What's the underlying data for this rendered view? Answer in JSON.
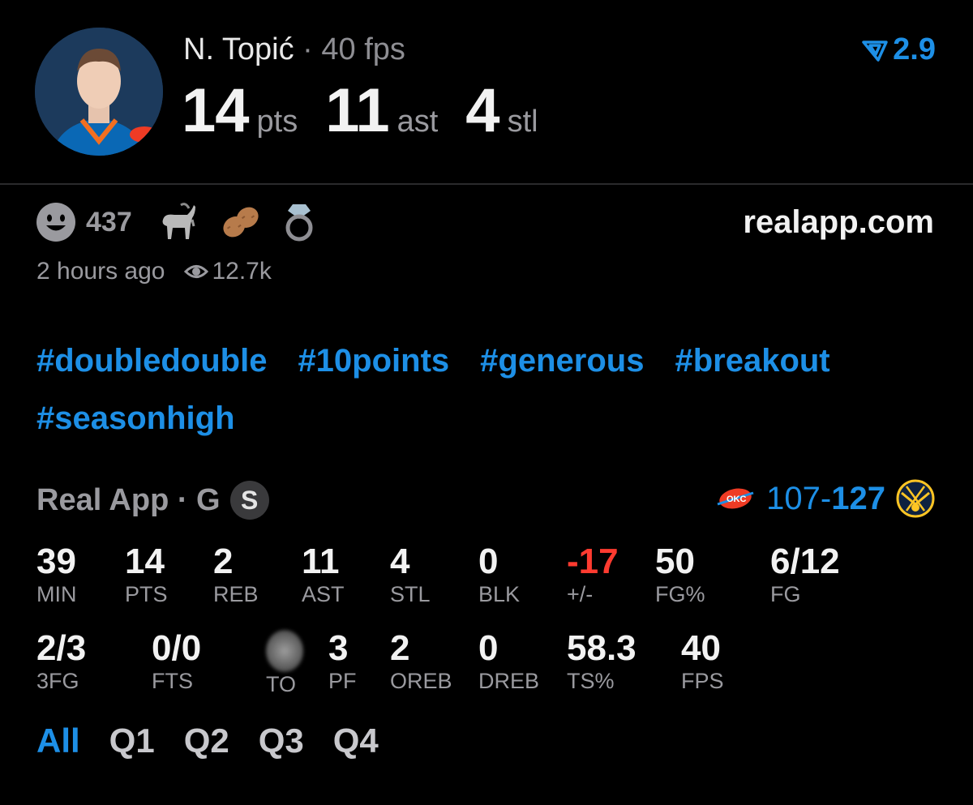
{
  "player": {
    "name": "N. Topić",
    "separator": "·",
    "fps_text": "40 fps",
    "headline": [
      {
        "value": "14",
        "unit": "pts"
      },
      {
        "value": "11",
        "unit": "ast"
      },
      {
        "value": "4",
        "unit": "stl"
      }
    ]
  },
  "rating": {
    "value": "2.9",
    "icon": "rating-arrow-icon",
    "color": "#1d8fe6"
  },
  "reactions": {
    "count": "437",
    "emojis": [
      "goat-icon",
      "peanut-icon",
      "ring-icon"
    ]
  },
  "site": "realapp.com",
  "meta": {
    "time": "2 hours ago",
    "views": "12.7k"
  },
  "hashtags": [
    "#doubledouble",
    "#10points",
    "#generous",
    "#breakout",
    "#seasonhigh"
  ],
  "game": {
    "source": "Real App · G",
    "badge": "S",
    "score_a": "107",
    "dash": "-",
    "score_b": "127",
    "team_a_logo": "okc-logo",
    "team_b_logo": "denver-logo"
  },
  "stats_row1": [
    {
      "value": "39",
      "label": "MIN"
    },
    {
      "value": "14",
      "label": "PTS"
    },
    {
      "value": "2",
      "label": "REB"
    },
    {
      "value": "11",
      "label": "AST"
    },
    {
      "value": "4",
      "label": "STL"
    },
    {
      "value": "0",
      "label": "BLK"
    },
    {
      "value": "-17",
      "label": "+/-"
    },
    {
      "value": "50",
      "label": "FG%"
    },
    {
      "value": "6/12",
      "label": "FG"
    }
  ],
  "stats_row2": [
    {
      "value": "2/3",
      "label": "3FG"
    },
    {
      "value": "0/0",
      "label": "FTS"
    },
    {
      "value": "",
      "label": "TO"
    },
    {
      "value": "3",
      "label": "PF"
    },
    {
      "value": "2",
      "label": "OREB"
    },
    {
      "value": "0",
      "label": "DREB"
    },
    {
      "value": "58.3",
      "label": "TS%"
    },
    {
      "value": "40",
      "label": "FPS"
    }
  ],
  "tabs": [
    "All",
    "Q1",
    "Q2",
    "Q3",
    "Q4"
  ],
  "active_tab": "All",
  "colors": {
    "accent": "#1d8fe6",
    "negative": "#ff3b30",
    "muted": "#9a9a9f"
  }
}
